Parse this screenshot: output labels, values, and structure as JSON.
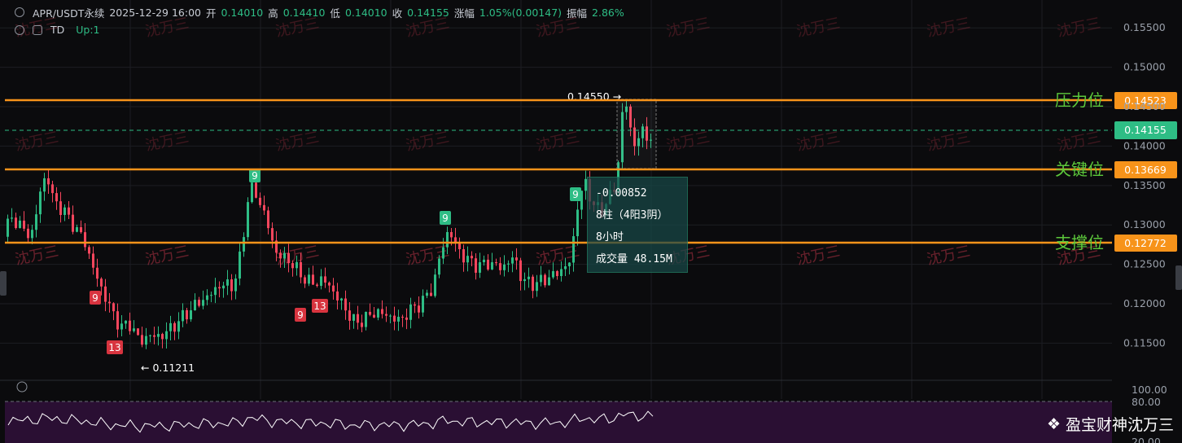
{
  "header": {
    "pair": "APR/USDT永续",
    "datetime": "2025-12-29 16:00",
    "open_label": "开",
    "open": "0.14010",
    "high_label": "高",
    "high": "0.14410",
    "low_label": "低",
    "low": "0.14010",
    "close_label": "收",
    "close": "0.14155",
    "change_label": "涨幅",
    "change": "1.05%(0.00147)",
    "amp_label": "振幅",
    "amplitude": "2.86%"
  },
  "indicator": {
    "name": "TD",
    "value": "Up:1"
  },
  "levels": {
    "resistance": {
      "label": "压力位",
      "price": "0.14523"
    },
    "key": {
      "label": "关键位",
      "price": "0.13669"
    },
    "support": {
      "label": "支撑位",
      "price": "0.12772"
    }
  },
  "current_price": "0.14155",
  "annotations": {
    "high_marker": "0.14550",
    "low_marker": "0.11211"
  },
  "measure_tooltip": {
    "delta": "-0.00852",
    "bars": "8柱（4阳3阴）",
    "duration": "8小时",
    "volume": "成交量 48.15M"
  },
  "watermark": "沈万三",
  "footer_brand": "盈宝财神沈万三",
  "colors": {
    "up": "#2ebd85",
    "down": "#f6465d",
    "level": "#f7931a",
    "level_text": "#5cc83b",
    "rsi_bg": "#2a0f33",
    "rsi_line": "#ffffff"
  },
  "chart_data": {
    "type": "candlestick",
    "y_axis_ticks": [
      "0.15500",
      "0.15000",
      "0.14500",
      "0.14000",
      "0.13500",
      "0.13000",
      "0.12500",
      "0.12000",
      "0.11500"
    ],
    "ylim": [
      0.1105,
      0.1575
    ],
    "td_labels": [
      {
        "text": "9",
        "color": "down"
      },
      {
        "text": "9",
        "color": "up"
      },
      {
        "text": "13",
        "color": "down"
      },
      {
        "text": "9",
        "color": "down"
      },
      {
        "text": "13",
        "color": "down"
      },
      {
        "text": "9",
        "color": "up"
      },
      {
        "text": "9",
        "color": "up"
      }
    ],
    "rsi_ticks": [
      "100.00",
      "80.00",
      "20.00"
    ]
  }
}
